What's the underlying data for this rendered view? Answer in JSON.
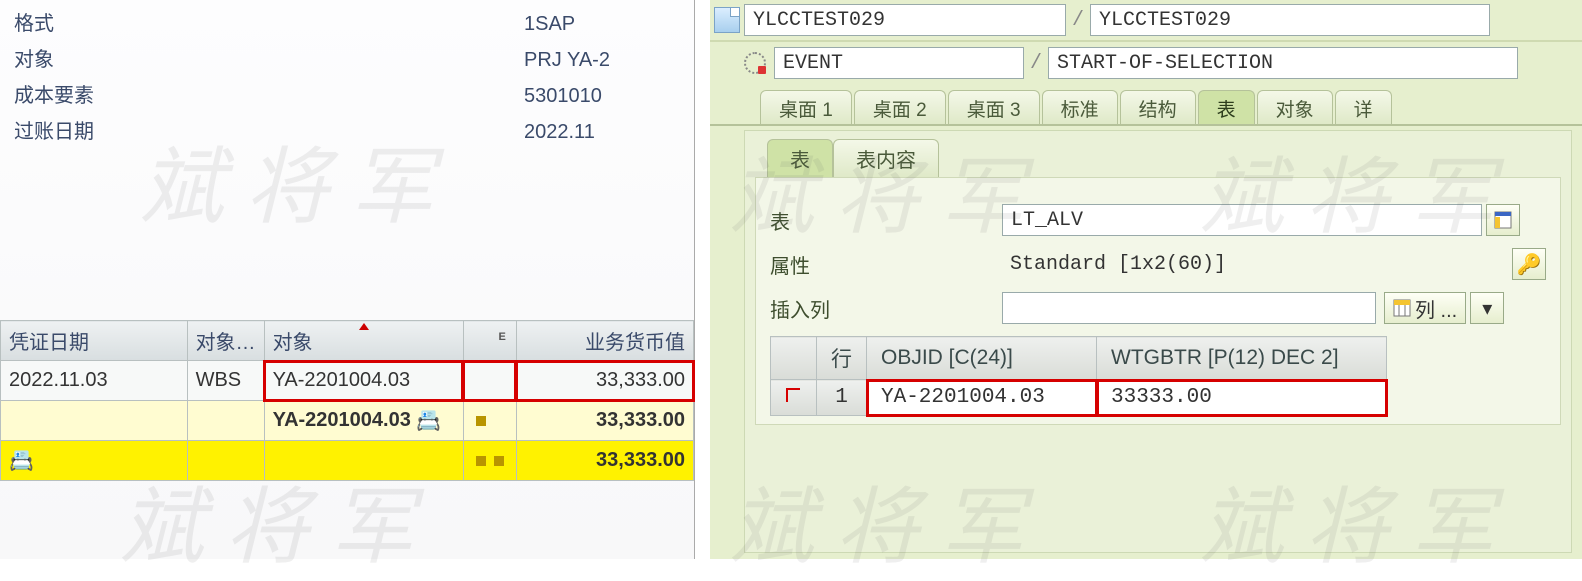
{
  "left": {
    "header": {
      "rows": [
        {
          "label": "格式",
          "value": "1SAP"
        },
        {
          "label": "对象",
          "value": "PRJ YA-2"
        },
        {
          "label": "成本要素",
          "value": "5301010"
        },
        {
          "label": "过账日期",
          "value": "2022.11"
        }
      ]
    },
    "table": {
      "cols": [
        "凭证日期",
        "对象…",
        "对象",
        "",
        "业务货币值"
      ],
      "rows": [
        {
          "c0": "2022.11.03",
          "c1": "WBS",
          "c2": "YA-2201004.03",
          "c3": "",
          "c4": "33,333.00",
          "style": "data",
          "hl": true
        },
        {
          "c0": "",
          "c1": "",
          "c2": "YA-2201004.03",
          "c3": "sum",
          "c4": "33,333.00",
          "style": "ylw"
        },
        {
          "c0": "",
          "c1": "",
          "c2": "",
          "c3": "sum",
          "c4": "33,333.00",
          "style": "ylw2"
        }
      ]
    }
  },
  "right": {
    "program_left": "YLCCTEST029",
    "program_right": "YLCCTEST029",
    "event": "EVENT",
    "block": "START-OF-SELECTION",
    "tabs": [
      "桌面 1",
      "桌面 2",
      "桌面 3",
      "标准",
      "结构",
      "表",
      "对象",
      "详"
    ],
    "active_tab": "表",
    "subtabs": [
      "表",
      "表内容"
    ],
    "active_subtab": "表",
    "fields": {
      "table_lbl": "表",
      "table_val": "LT_ALV",
      "attr_lbl": "属性",
      "attr_val": "Standard [1x2(60)]",
      "insert_lbl": "插入列",
      "insert_val": "",
      "cols_btn": "列 ..."
    },
    "grid": {
      "cols": [
        "行",
        "OBJID [C(24)]",
        "WTGBTR [P(12) DEC 2]"
      ],
      "rows": [
        {
          "n": "1",
          "objid": "YA-2201004.03",
          "wtgbtr": "33333.00"
        }
      ]
    }
  },
  "watermark": "斌 将 军"
}
